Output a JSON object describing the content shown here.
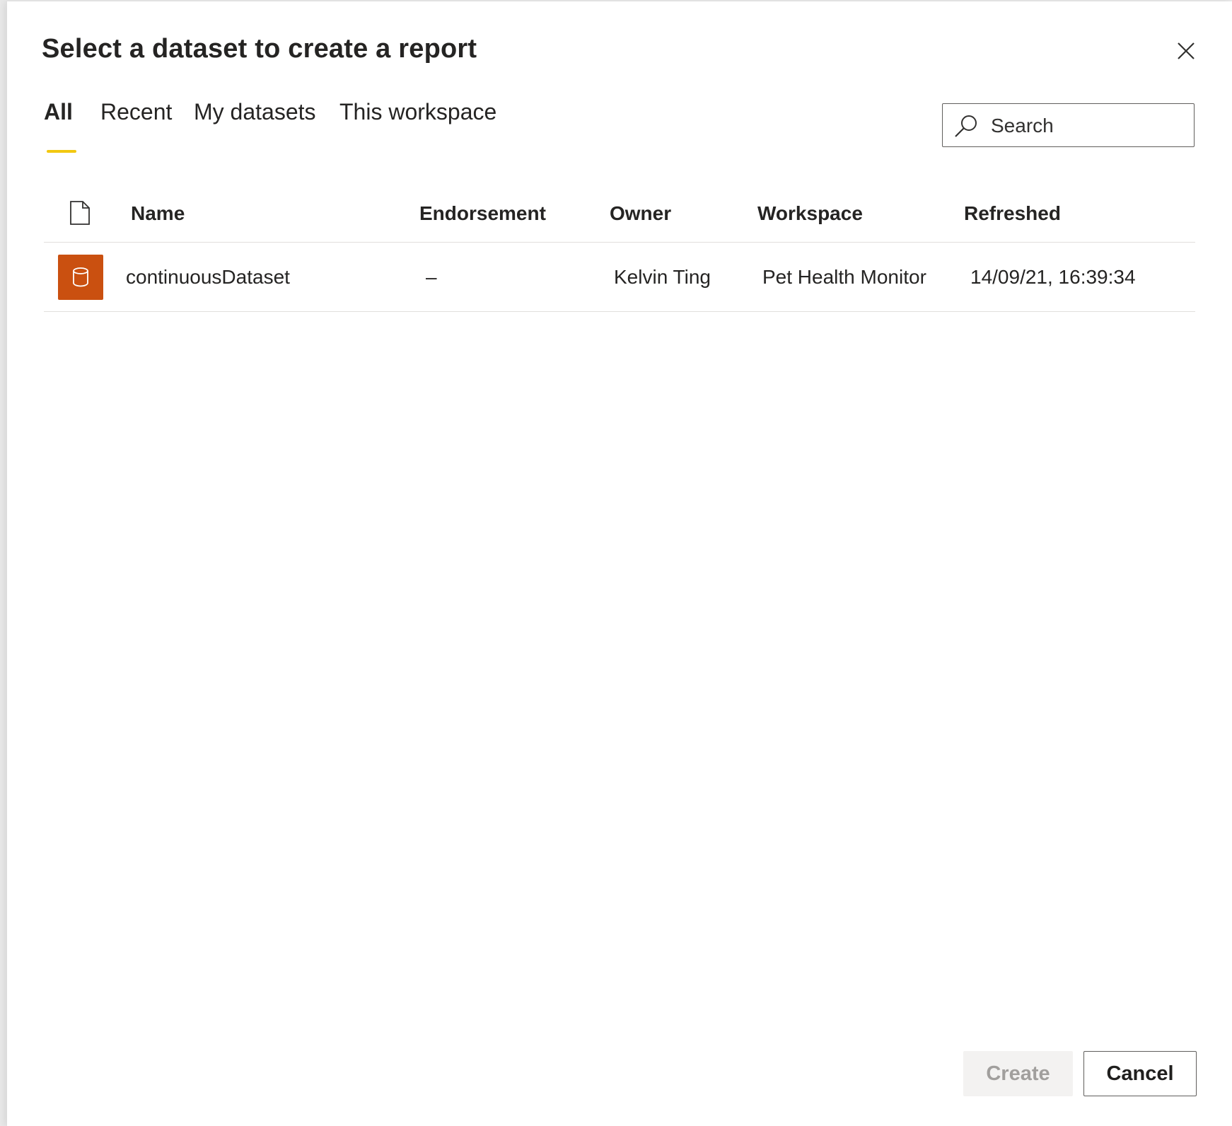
{
  "dialog": {
    "title": "Select a dataset to create a report"
  },
  "tabs": [
    {
      "label": "All",
      "active": true
    },
    {
      "label": "Recent",
      "active": false
    },
    {
      "label": "My datasets",
      "active": false
    },
    {
      "label": "This workspace",
      "active": false
    }
  ],
  "search": {
    "placeholder": "Search",
    "value": ""
  },
  "table": {
    "columns": [
      "Name",
      "Endorsement",
      "Owner",
      "Workspace",
      "Refreshed"
    ],
    "rows": [
      {
        "icon": "dataset-icon",
        "name": "continuousDataset",
        "endorsement": "–",
        "owner": "Kelvin Ting",
        "workspace": "Pet Health Monitor",
        "refreshed": "14/09/21, 16:39:34"
      }
    ]
  },
  "buttons": {
    "create_label": "Create",
    "cancel_label": "Cancel"
  },
  "colors": {
    "accent_tab": "#f2c811",
    "dataset_icon_bg": "#ca5010",
    "text": "#252423"
  }
}
